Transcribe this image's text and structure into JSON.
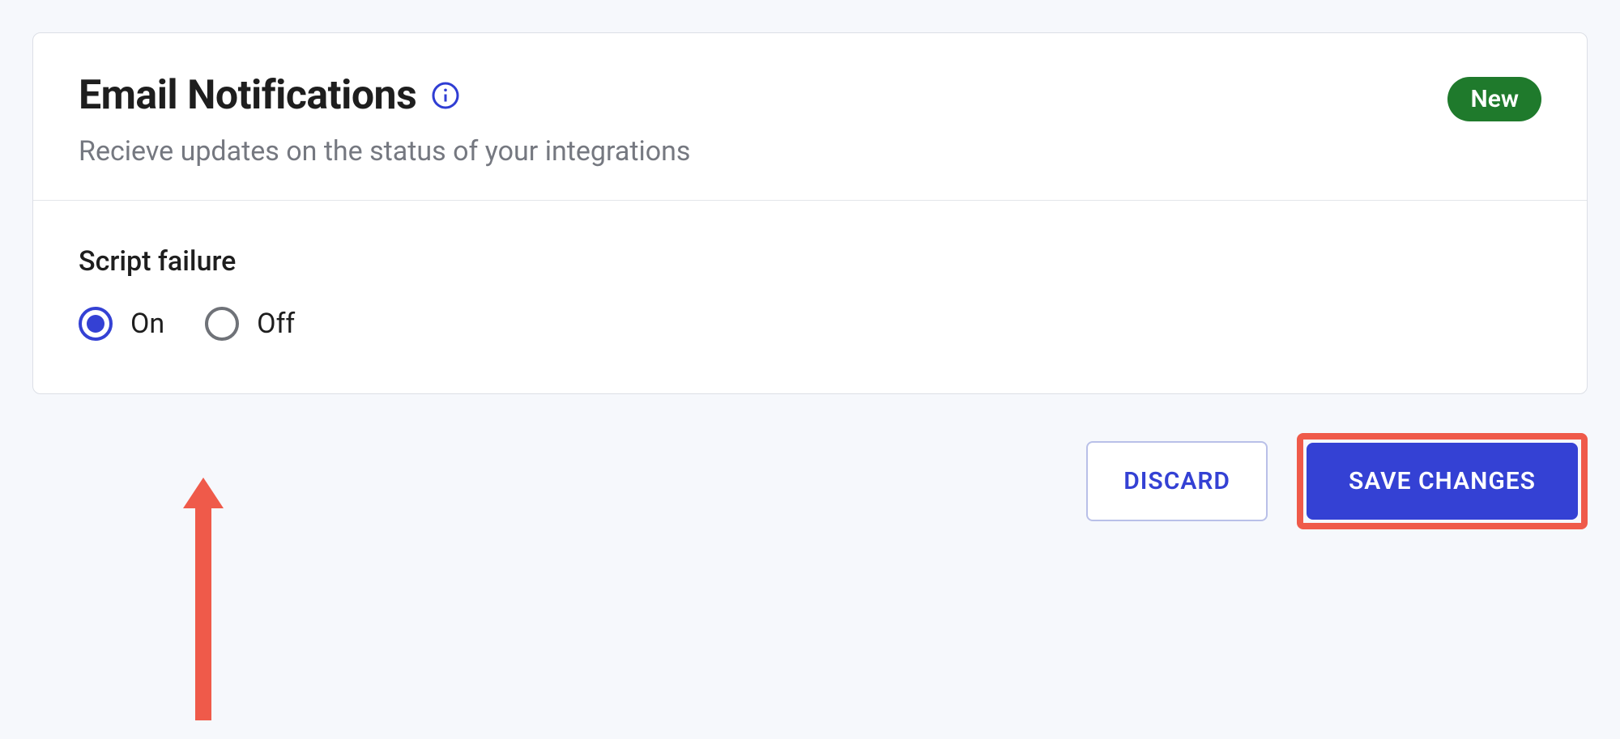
{
  "card": {
    "title": "Email Notifications",
    "subtitle": "Recieve updates on the status of your integrations",
    "badge": "New"
  },
  "setting": {
    "label": "Script failure",
    "options": {
      "on": "On",
      "off": "Off"
    }
  },
  "buttons": {
    "discard": "DISCARD",
    "save": "SAVE CHANGES"
  }
}
